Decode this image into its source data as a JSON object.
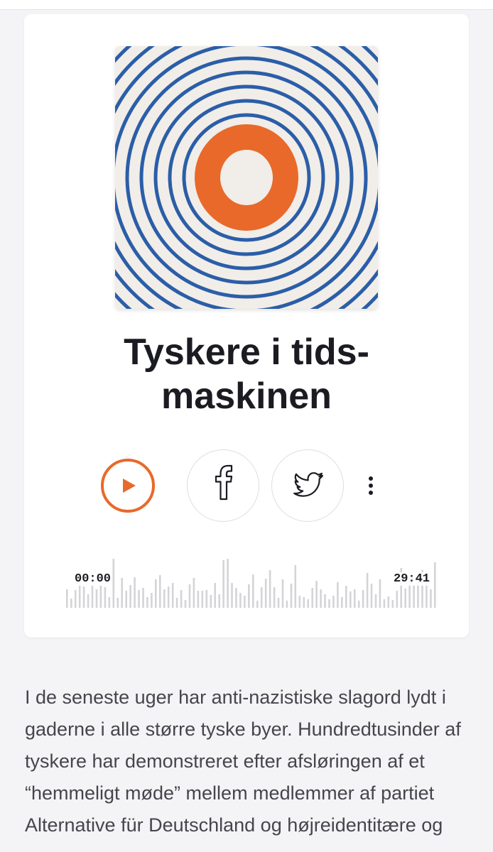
{
  "episode": {
    "title_line1": "Tyskere i tids-",
    "title_line2": "maskinen",
    "cover_icon": "concentric-circles-logo"
  },
  "player": {
    "current_time": "00:00",
    "duration": "29:41",
    "progress": 0,
    "accent_color": "#e8692a"
  },
  "share": {
    "facebook_icon": "facebook-icon",
    "twitter_icon": "twitter-icon",
    "more_icon": "more-vertical-icon"
  },
  "description": "I de seneste uger har anti-nazistiske slagord lydt i gaderne i alle større tyske byer. Hundredtusinder af tyskere har demonstreret efter afsløringen af et “hemmeligt møde” mellem medlemmer af partiet Alternative für Deutschland og højreidentitære og"
}
